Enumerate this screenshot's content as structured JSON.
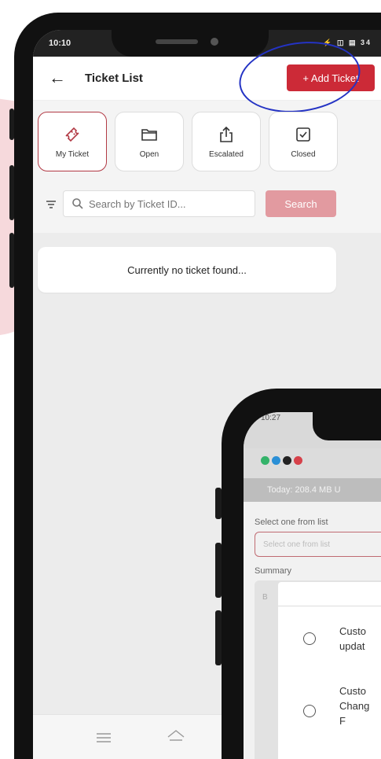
{
  "status": {
    "time": "10:10",
    "icons": "⚡ ◫ ▤ 34"
  },
  "header": {
    "title": "Ticket List",
    "add_label": "+ Add Ticket"
  },
  "cards": [
    {
      "label": "My Ticket",
      "icon": "ticket-icon",
      "active": true
    },
    {
      "label": "Open",
      "icon": "folder-icon",
      "active": false
    },
    {
      "label": "Escalated",
      "icon": "escalate-icon",
      "active": false
    },
    {
      "label": "Closed",
      "icon": "check-box-icon",
      "active": false
    }
  ],
  "search": {
    "placeholder": "Search by Ticket ID...",
    "button_label": "Search"
  },
  "empty_message": "Currently no ticket found...",
  "colors": {
    "brand": "#cc2a37",
    "search_button": "#e29aa0",
    "annotation": "#2433c4"
  },
  "phone2": {
    "time": "10:27",
    "today": "Today: 208.4 MB U",
    "select_label": "Select one from list",
    "select_placeholder": "Select one from list",
    "summary_label": "Summary",
    "summary_placeholder": "B",
    "options": [
      {
        "line1": "Custo",
        "line2": "updat"
      },
      {
        "line1": "Custo",
        "line2": "Chang",
        "line3": "F"
      }
    ]
  }
}
